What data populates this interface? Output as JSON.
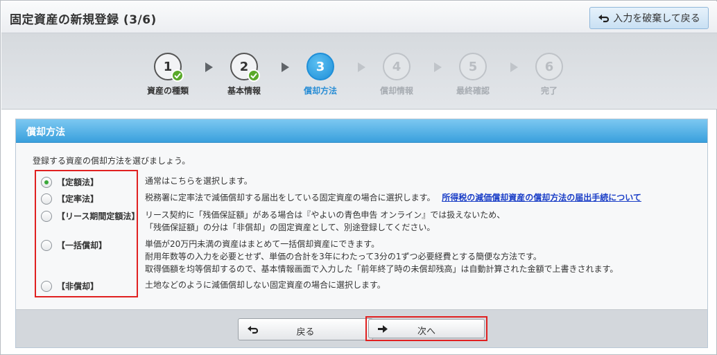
{
  "header": {
    "title": "固定資産の新規登録 (3/6)",
    "discard_label": "入力を破棄して戻る"
  },
  "stepper": {
    "steps": [
      {
        "number": "1",
        "label": "資産の種類",
        "state": "done"
      },
      {
        "number": "2",
        "label": "基本情報",
        "state": "done"
      },
      {
        "number": "3",
        "label": "償却方法",
        "state": "active"
      },
      {
        "number": "4",
        "label": "償却情報",
        "state": "todo"
      },
      {
        "number": "5",
        "label": "最終確認",
        "state": "todo"
      },
      {
        "number": "6",
        "label": "完了",
        "state": "todo"
      }
    ]
  },
  "panel": {
    "title": "償却方法",
    "instruction": "登録する資産の償却方法を選びましょう。",
    "options": [
      {
        "label": "【定額法】",
        "selected": true,
        "desc": [
          "通常はこちらを選択します。"
        ]
      },
      {
        "label": "【定率法】",
        "selected": false,
        "desc": [
          "税務署に定率法で減価償却する届出をしている固定資産の場合に選択します。"
        ],
        "link": "所得税の減価償却資産の償却方法の届出手続について"
      },
      {
        "label": "【リース期間定額法】",
        "selected": false,
        "desc": [
          "リース契約に「残価保証額」がある場合は『やよいの青色申告 オンライン』では扱えないため、",
          "「残価保証額」の分は「非償却」の固定資産として、別途登録してください。"
        ]
      },
      {
        "label": "【一括償却】",
        "selected": false,
        "desc": [
          "単価が20万円未満の資産はまとめて一括償却資産にできます。",
          "耐用年数等の入力を必要とせず、単価の合計を3年にわたって3分の1ずつ必要経費とする簡便な方法です。",
          "取得価額を均等償却するので、基本情報画面で入力した「前年終了時の未償却残高」は自動計算された金額で上書きされます。"
        ]
      },
      {
        "label": "【非償却】",
        "selected": false,
        "desc": [
          "土地などのように減価償却しない固定資産の場合に選択します。"
        ]
      }
    ]
  },
  "footer": {
    "back_label": "戻る",
    "next_label": "次へ"
  },
  "colors": {
    "accent": "#2a8ed5",
    "highlight_box": "#e02020",
    "check_green": "#5aa92a"
  }
}
